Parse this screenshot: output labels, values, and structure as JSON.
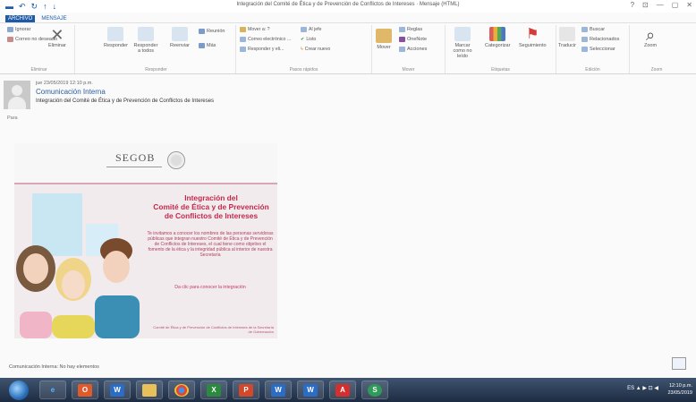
{
  "window": {
    "title": "Integración del Comité de Ética y de Prevención de Conflictos de Intereses · Mensaje (HTML)",
    "controls": [
      "?",
      "⊡",
      "—",
      "▢",
      "✕"
    ]
  },
  "tabs": [
    "ARCHIVO",
    "MENSAJE"
  ],
  "ribbon": {
    "groups": [
      "Eliminar",
      "Responder",
      "Pasos rápidos",
      "Mover",
      "Etiquetas",
      "Edición",
      "Zoom"
    ],
    "ignore": "Ignorar",
    "junk": "Correo no deseado",
    "delete": "Eliminar",
    "reply": "Responder",
    "reply_all": "Responder a todos",
    "forward": "Reenviar",
    "meeting": "Reunión",
    "more": "Más",
    "quick_steps": [
      "Mover a: ?",
      "Correo electrónico ...",
      "Responder y eli...",
      "Al jefe",
      "Listo",
      "Crear nuevo"
    ],
    "move": "Mover",
    "rules": "Reglas",
    "onenote": "OneNote",
    "actions": "Acciones",
    "mark_unread": "Marcar como no leído",
    "categorize": "Categorizar",
    "follow_up": "Seguimiento",
    "translate": "Traducir",
    "find": "Buscar",
    "related": "Relacionados",
    "select": "Seleccionar",
    "zoom": "Zoom"
  },
  "message": {
    "date": "jue 23/05/2019 12:10 p.m.",
    "from": "Comunicación Interna",
    "subject": "Integración del Comité de Ética y de Prevención de Conflictos de Intereses",
    "para": "Para"
  },
  "banner": {
    "org": "SEGOB",
    "title_lines": [
      "Integración del",
      "Comité de Ética y de Prevención",
      "de Conflictos de Intereses"
    ],
    "body": "Te invitamos a conocer los nombres de las personas servidoras públicas que integran nuestro Comité de Ética y de Prevención de Conflictos de Intereses, el cual tiene como objetivo el fomento de la ética y la integridad pública al interior de nuestra Secretaría",
    "link": "Da clic para conocer la integración",
    "footer": "Comité de Ética y de Prevención de Conflictos de Intereses de la Secretaría de Gobernación"
  },
  "footer": {
    "text": "Comunicación Interna: No hay elementos"
  },
  "taskbar": {
    "apps": [
      "e",
      "O",
      "W",
      "X",
      "P",
      "W",
      "W",
      "A",
      "S"
    ],
    "tray": "ES ▲ ▶ ⊡ ◀",
    "time": "12:10 p.m.",
    "date": "23/05/2019"
  },
  "colors": {
    "accent": "#1e5aa8",
    "banner_title": "#c22a4b",
    "taskbar": "#2a3b55"
  }
}
